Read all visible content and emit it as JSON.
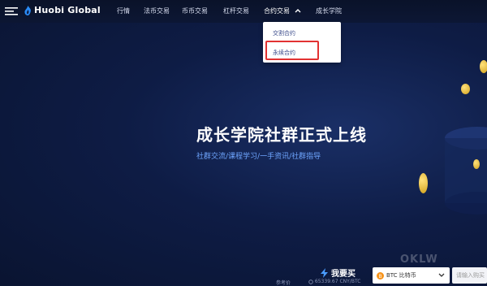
{
  "brand": {
    "name": "Huobi Global"
  },
  "nav": {
    "items": [
      {
        "label": "行情"
      },
      {
        "label": "法币交易"
      },
      {
        "label": "币币交易"
      },
      {
        "label": "杠杆交易"
      },
      {
        "label": "合约交易"
      },
      {
        "label": "成长学院"
      }
    ]
  },
  "dropdown": {
    "items": [
      {
        "label": "交割合约"
      },
      {
        "label": "永续合约"
      }
    ]
  },
  "hero": {
    "title": "成长学院社群正式上线",
    "subtitle": "社群交流/课程学习/一手资讯/社群指导"
  },
  "trade": {
    "buy_label": "我要买",
    "ref_label": "参考价",
    "ref_value": "65339.67 CNY/BTC",
    "select_value": "BTC 比特币",
    "input_placeholder": "请输入购买"
  },
  "watermark": "OKLW",
  "colors": {
    "accent": "#6fa6ff",
    "highlight": "#e23232",
    "background": "#0e1c45"
  }
}
